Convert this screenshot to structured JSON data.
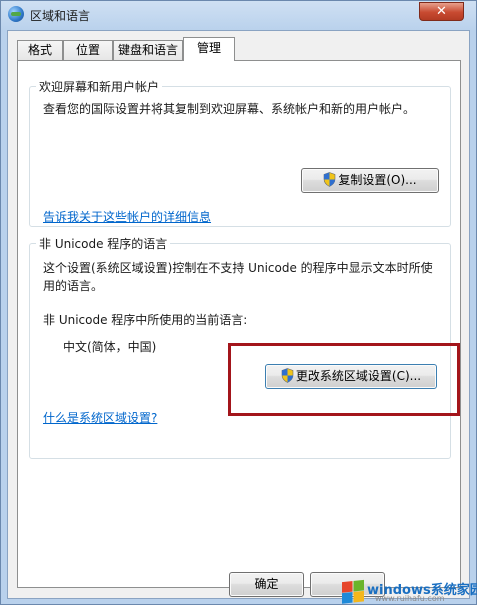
{
  "window": {
    "title": "区域和语言",
    "close_glyph": "✕"
  },
  "tabs": [
    {
      "label": "格式",
      "active": false
    },
    {
      "label": "位置",
      "active": false
    },
    {
      "label": "键盘和语言",
      "active": false
    },
    {
      "label": "管理",
      "active": true
    }
  ],
  "welcome_group": {
    "title": "欢迎屏幕和新用户帐户",
    "description": "查看您的国际设置并将其复制到欢迎屏幕、系统帐户和新的用户帐户。",
    "copy_button": "复制设置(O)...",
    "details_link": "告诉我关于这些帐户的详细信息"
  },
  "unicode_group": {
    "title": "非 Unicode 程序的语言",
    "description_line1": "这个设置(系统区域设置)控制在不支持 Unicode 的程序中显示文本时所使",
    "description_line2": "用的语言。",
    "current_label": "非 Unicode 程序中所使用的当前语言:",
    "current_value": "中文(简体，中国)",
    "change_button": "更改系统区域设置(C)...",
    "help_link": "什么是系统区域设置?"
  },
  "footer": {
    "ok_button": "确定"
  },
  "watermark": {
    "brand": "windows系统家园",
    "url": "www.ruihafu.com"
  },
  "colors": {
    "link": "#0066cc",
    "highlight_box": "#a3151b",
    "close_button": "#c84a31"
  }
}
